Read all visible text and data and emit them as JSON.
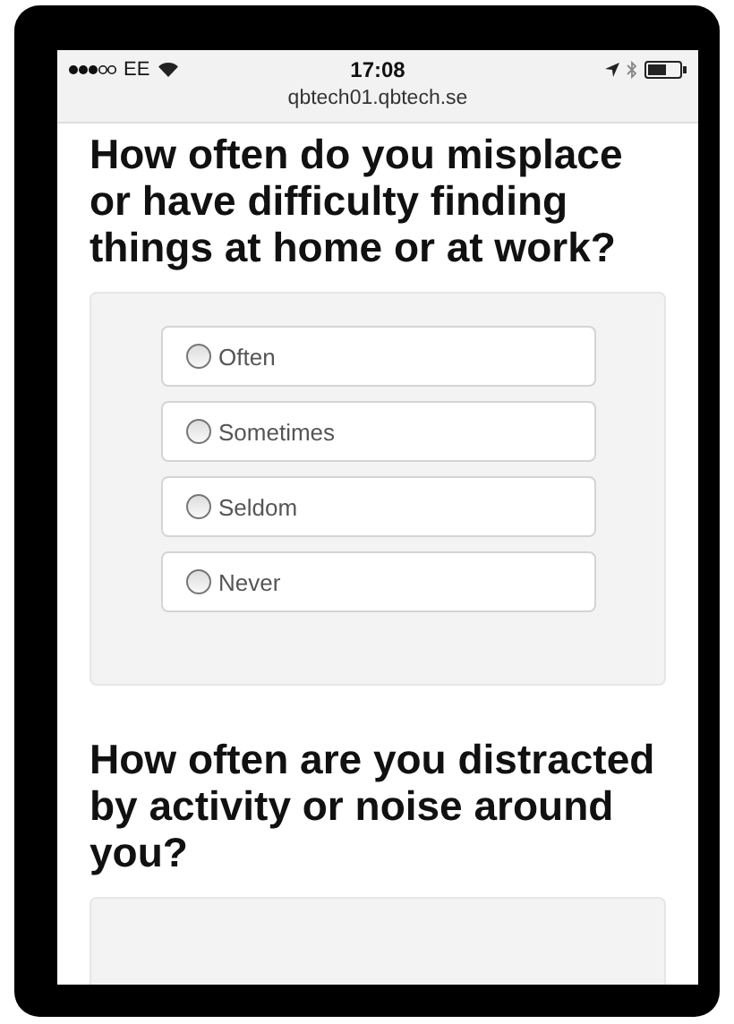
{
  "status_bar": {
    "carrier": "EE",
    "time": "17:08",
    "url": "qbtech01.qbtech.se"
  },
  "questions": [
    {
      "title": "How often do you misplace or have difficulty finding things at home or at work?",
      "options": [
        {
          "label": "Often",
          "selected": false
        },
        {
          "label": "Sometimes",
          "selected": false
        },
        {
          "label": "Seldom",
          "selected": false
        },
        {
          "label": "Never",
          "selected": false
        }
      ]
    },
    {
      "title": "How often are you distracted by activity or noise around you?"
    }
  ]
}
